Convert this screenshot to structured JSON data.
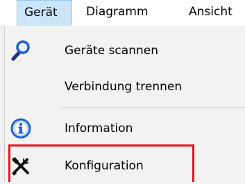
{
  "menubar": {
    "items": [
      {
        "label": "Gerät",
        "active": true
      },
      {
        "label": "Diagramm",
        "active": false
      },
      {
        "label": "Ansicht",
        "active": false
      }
    ]
  },
  "dropdown": {
    "items": [
      {
        "label": "Geräte scannen",
        "icon": "magnifier-icon"
      },
      {
        "label": "Verbindung trennen",
        "icon": null
      },
      {
        "label": "Information",
        "icon": "info-icon"
      },
      {
        "label": "Konfiguration",
        "icon": "tools-icon"
      }
    ]
  },
  "colors": {
    "highlight_border": "#e8141c",
    "active_menu_bg": "#cce4f7",
    "info_blue": "#1a5fd6"
  }
}
